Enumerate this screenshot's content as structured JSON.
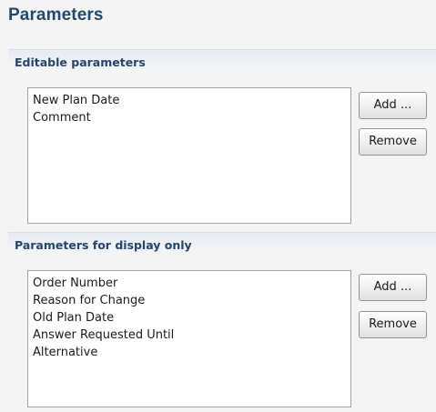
{
  "page": {
    "title": "Parameters"
  },
  "editable": {
    "title": "Editable parameters",
    "items": [
      "New Plan Date",
      "Comment"
    ],
    "add_label": "Add ...",
    "remove_label": "Remove"
  },
  "display_only": {
    "title": "Parameters for display only",
    "items": [
      "Order Number",
      "Reason for Change",
      "Old Plan Date",
      "Answer Requested Until",
      "Alternative"
    ],
    "add_label": "Add ...",
    "remove_label": "Remove"
  },
  "colors": {
    "title_text": "#27476f",
    "section_header_bg": "#e6ebf2",
    "page_bg": "#f4f4f4"
  }
}
